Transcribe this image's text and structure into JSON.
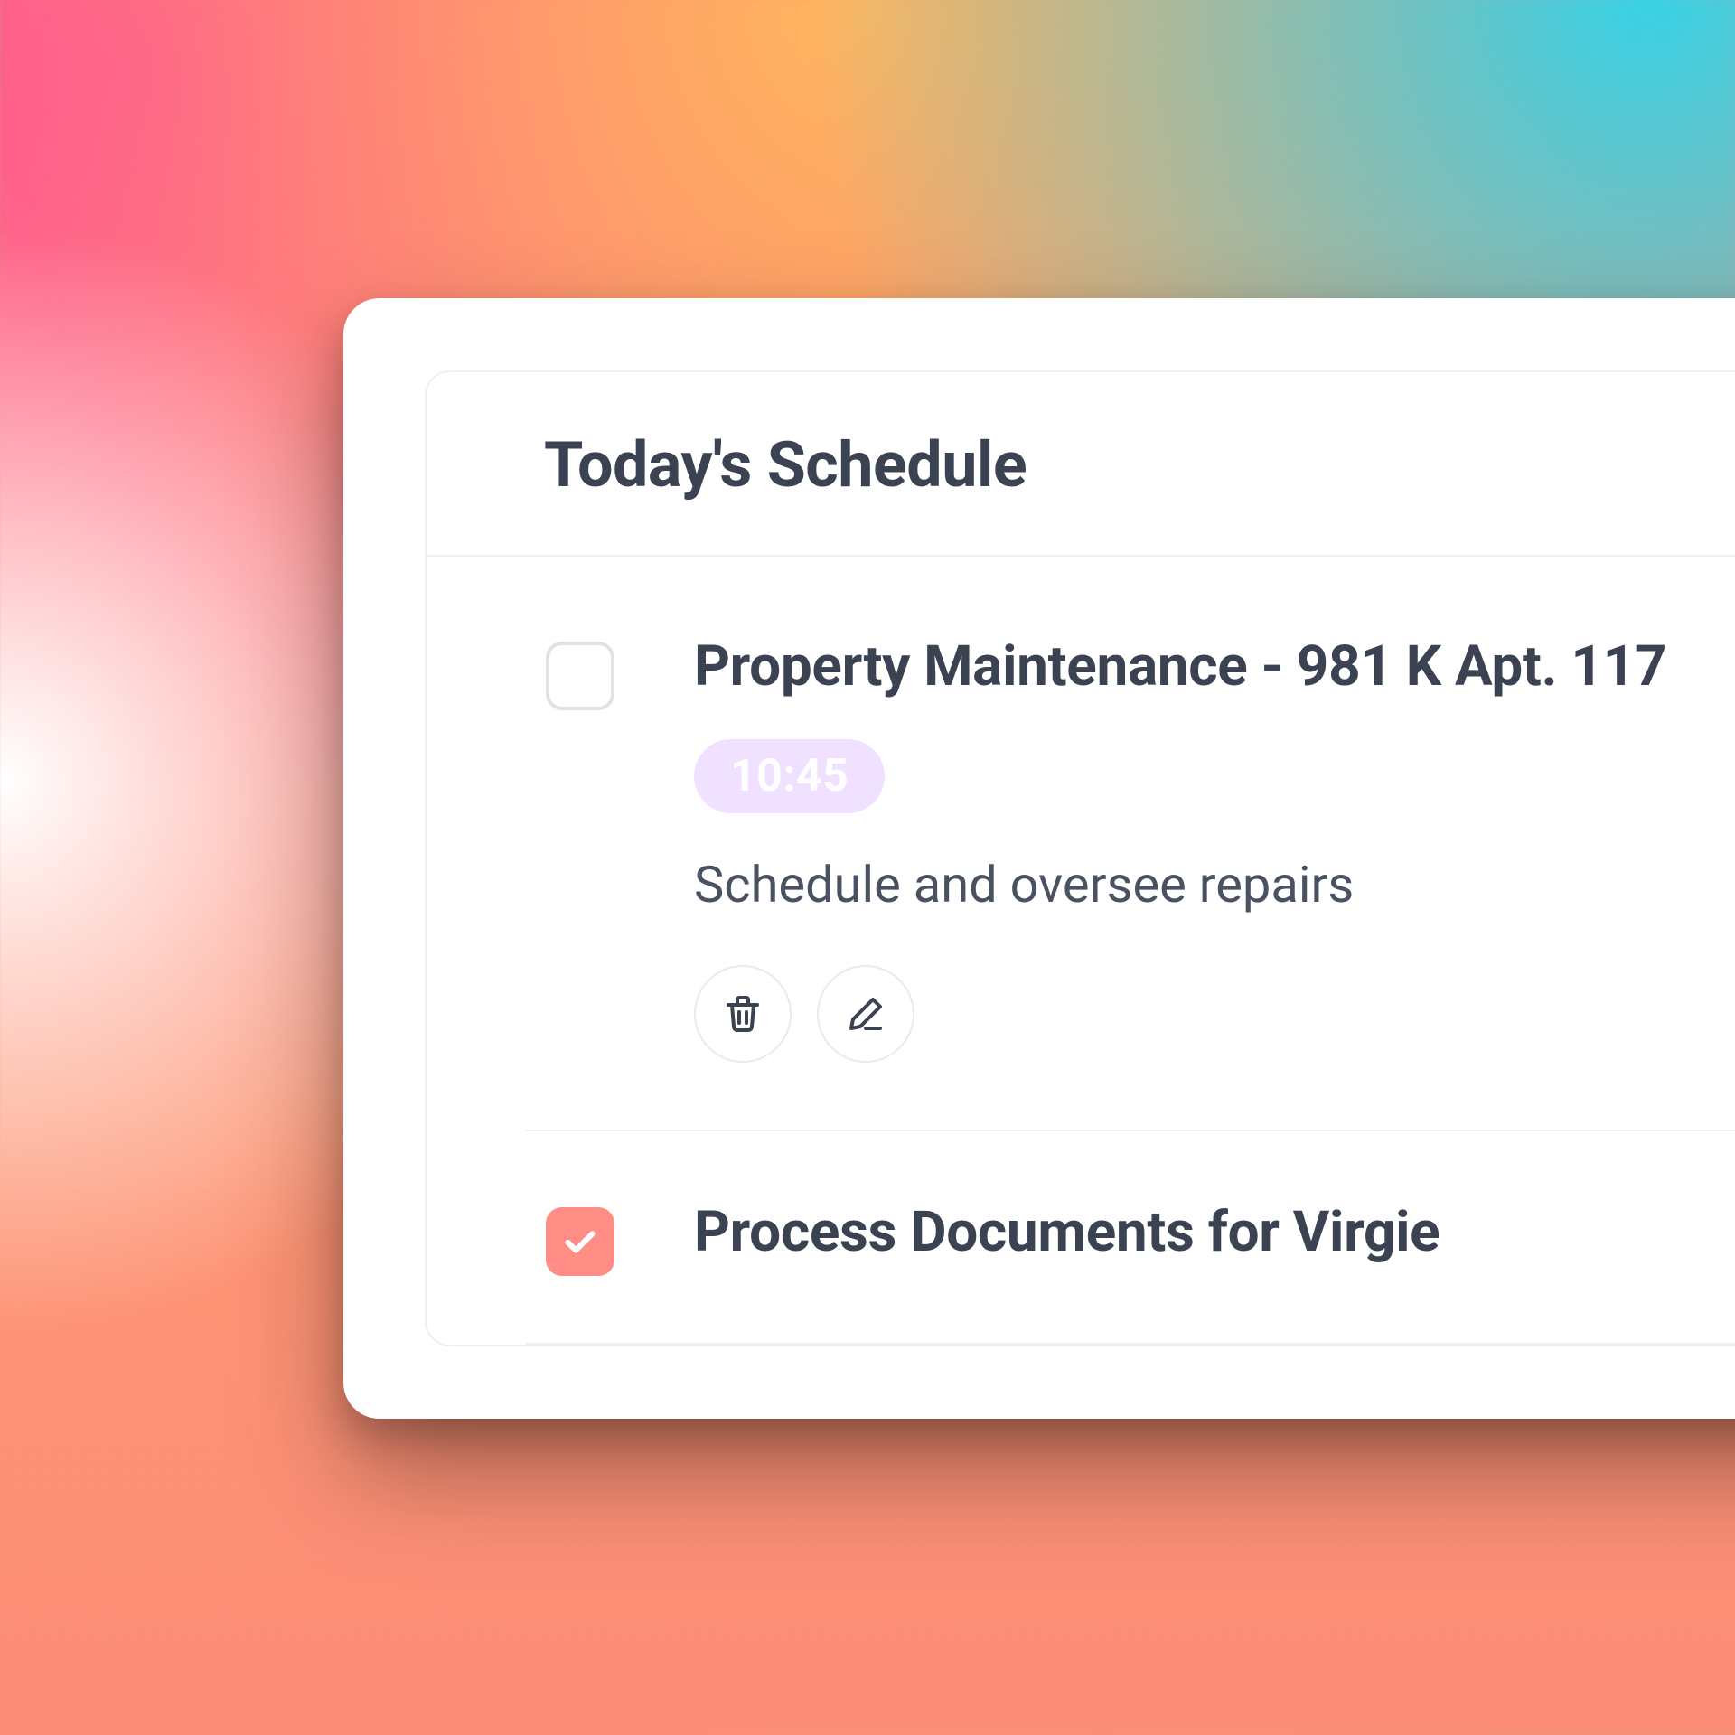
{
  "schedule": {
    "heading": "Today's Schedule",
    "items": [
      {
        "checked": false,
        "title": "Property Maintenance - 981 K Apt. 117",
        "time": "10:45",
        "description": "Schedule and oversee repairs"
      },
      {
        "checked": true,
        "title": "Process Documents for Virgie"
      }
    ]
  },
  "colors": {
    "badge_bg": "#efe1ff",
    "badge_text": "#ffffff",
    "checked_bg": "#ff8d85",
    "text_primary": "#3b4252"
  }
}
